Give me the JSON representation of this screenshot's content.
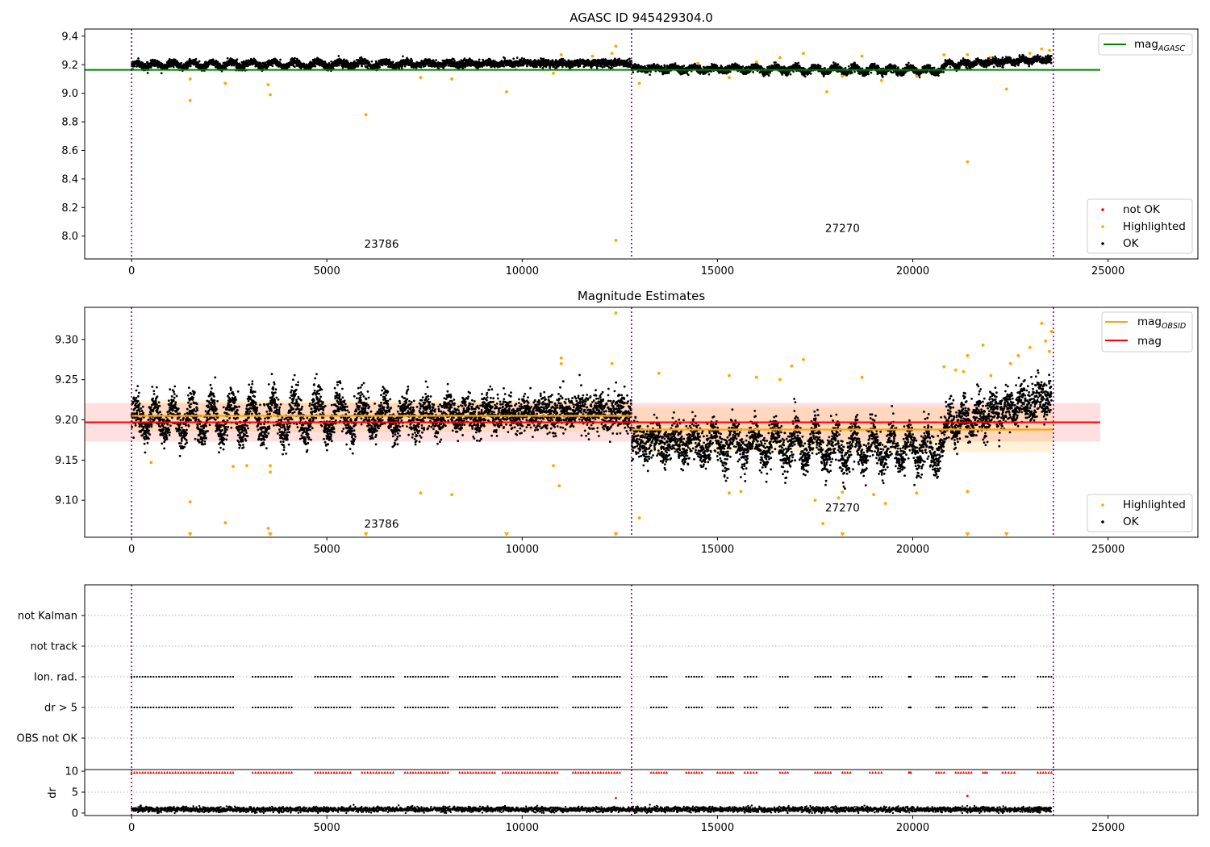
{
  "chart_data": [
    {
      "type": "scatter",
      "title": "AGASC ID 945429304.0",
      "xlim": [
        -1200,
        27300
      ],
      "ylim": [
        7.84,
        9.45
      ],
      "xticks": [
        0,
        5000,
        10000,
        15000,
        20000,
        25000
      ],
      "yticks": [
        8.0,
        8.2,
        8.4,
        8.6,
        8.8,
        9.0,
        9.2,
        9.4
      ],
      "vertical_lines": [
        0,
        12800,
        23600
      ],
      "reference_line": {
        "name_main": "mag",
        "name_sub": "AGASC",
        "value": 9.164,
        "x_range": [
          -1200,
          24800
        ],
        "color": "#008000"
      },
      "annotations": [
        {
          "text": "23786",
          "x": 6400,
          "y": 7.92
        },
        {
          "text": "27270",
          "x": 18200,
          "y": 8.03
        }
      ],
      "series": [
        {
          "name": "not OK",
          "color": "#ff0000",
          "points": []
        },
        {
          "name": "Highlighted",
          "color": "#ffa500",
          "points": [
            [
              1500,
              8.95
            ],
            [
              1500,
              9.1
            ],
            [
              2400,
              9.07
            ],
            [
              3500,
              9.06
            ],
            [
              3550,
              8.99
            ],
            [
              6000,
              8.85
            ],
            [
              7400,
              9.11
            ],
            [
              8200,
              9.1
            ],
            [
              9600,
              9.01
            ],
            [
              10800,
              9.14
            ],
            [
              11000,
              9.27
            ],
            [
              11800,
              9.26
            ],
            [
              12300,
              9.28
            ],
            [
              12400,
              9.33
            ],
            [
              12400,
              7.97
            ],
            [
              13000,
              9.07
            ],
            [
              14500,
              9.21
            ],
            [
              15300,
              9.11
            ],
            [
              16000,
              9.22
            ],
            [
              16600,
              9.25
            ],
            [
              17200,
              9.28
            ],
            [
              17800,
              9.01
            ],
            [
              18200,
              9.12
            ],
            [
              18700,
              9.26
            ],
            [
              19200,
              9.09
            ],
            [
              20100,
              9.12
            ],
            [
              20800,
              9.27
            ],
            [
              21400,
              9.27
            ],
            [
              21400,
              8.52
            ],
            [
              22000,
              9.25
            ],
            [
              22400,
              9.03
            ],
            [
              23000,
              9.28
            ],
            [
              23300,
              9.31
            ],
            [
              23500,
              9.3
            ]
          ]
        },
        {
          "name": "OK",
          "color": "#000000",
          "segments": [
            {
              "x0": 0,
              "x1": 12800,
              "base": 9.2,
              "amp": 0.02,
              "noise": 0.012,
              "period": 520,
              "trend": 0.012
            },
            {
              "x0": 12800,
              "x1": 20800,
              "base": 9.173,
              "amp": 0.02,
              "noise": 0.012,
              "period": 480,
              "trend": -0.01
            },
            {
              "x0": 20800,
              "x1": 23550,
              "base": 9.2,
              "amp": 0.02,
              "noise": 0.012,
              "period": 400,
              "trend": 0.04
            }
          ]
        }
      ],
      "legend_upper": {
        "position": "upper right",
        "entries": [
          {
            "label_main": "mag",
            "label_sub": "AGASC",
            "color": "#008000",
            "kind": "line"
          }
        ]
      },
      "legend_lower": {
        "position": "lower right",
        "entries": [
          {
            "label": "not OK",
            "color": "#ff0000",
            "kind": "dot"
          },
          {
            "label": "Highlighted",
            "color": "#ffa500",
            "kind": "dot"
          },
          {
            "label": "OK",
            "color": "#000000",
            "kind": "dot"
          }
        ]
      }
    },
    {
      "type": "scatter",
      "title": "Magnitude Estimates",
      "xlim": [
        -1200,
        27300
      ],
      "ylim": [
        9.054,
        9.34
      ],
      "xticks": [
        0,
        5000,
        10000,
        15000,
        20000,
        25000
      ],
      "yticks": [
        9.1,
        9.15,
        9.2,
        9.25,
        9.3
      ],
      "ytick_labels": [
        "9.10",
        "9.15",
        "9.20",
        "9.25",
        "9.30"
      ],
      "vertical_lines": [
        0,
        12800,
        23600
      ],
      "mag_line": {
        "name": "mag",
        "value": 9.197,
        "band": [
          9.173,
          9.221
        ],
        "x_range": [
          -1200,
          24800
        ],
        "color": "#ff0000"
      },
      "obsid_mags": [
        {
          "x0": 0,
          "x1": 12800,
          "value": 9.205,
          "band": [
            9.185,
            9.225
          ]
        },
        {
          "x0": 12800,
          "x1": 23600,
          "value": 9.188,
          "band": [
            9.16,
            9.216
          ]
        }
      ],
      "annotations": [
        {
          "text": "23786",
          "x": 6400,
          "y": 9.066
        },
        {
          "text": "27270",
          "x": 18200,
          "y": 9.086
        }
      ],
      "series": [
        {
          "name": "Highlighted",
          "color": "#ffa500",
          "points": [
            [
              500,
              9.147
            ],
            [
              1500,
              9.098
            ],
            [
              2400,
              9.072
            ],
            [
              2600,
              9.142
            ],
            [
              2950,
              9.143
            ],
            [
              3500,
              9.065
            ],
            [
              3550,
              9.135
            ],
            [
              3550,
              9.143
            ],
            [
              7400,
              9.109
            ],
            [
              8200,
              9.107
            ],
            [
              10800,
              9.143
            ],
            [
              10950,
              9.118
            ],
            [
              11000,
              9.27
            ],
            [
              11000,
              9.277
            ],
            [
              12400,
              9.333
            ],
            [
              12300,
              9.27
            ],
            [
              13000,
              9.078
            ],
            [
              13500,
              9.258
            ],
            [
              15300,
              9.109
            ],
            [
              15600,
              9.111
            ],
            [
              15300,
              9.255
            ],
            [
              16000,
              9.253
            ],
            [
              16600,
              9.25
            ],
            [
              16900,
              9.267
            ],
            [
              17200,
              9.275
            ],
            [
              17500,
              9.1
            ],
            [
              17700,
              9.071
            ],
            [
              18100,
              9.103
            ],
            [
              18200,
              9.11
            ],
            [
              18700,
              9.253
            ],
            [
              19000,
              9.107
            ],
            [
              19300,
              9.096
            ],
            [
              20100,
              9.109
            ],
            [
              20800,
              9.266
            ],
            [
              21100,
              9.262
            ],
            [
              21300,
              9.26
            ],
            [
              21400,
              9.111
            ],
            [
              21400,
              9.28
            ],
            [
              21800,
              9.293
            ],
            [
              22000,
              9.255
            ],
            [
              22500,
              9.27
            ],
            [
              22700,
              9.28
            ],
            [
              23000,
              9.29
            ],
            [
              23300,
              9.32
            ],
            [
              23400,
              9.298
            ],
            [
              23500,
              9.285
            ],
            [
              23550,
              9.31
            ]
          ]
        },
        {
          "name": "Highlighted-clipped",
          "color": "#ffa500",
          "points": [
            [
              1500,
              9.057
            ],
            [
              3550,
              9.057
            ],
            [
              6000,
              9.057
            ],
            [
              9600,
              9.057
            ],
            [
              12400,
              9.057
            ],
            [
              18200,
              9.057
            ],
            [
              21400,
              9.057
            ],
            [
              22400,
              9.057
            ]
          ]
        },
        {
          "name": "OK",
          "color": "#000000",
          "segments": [
            {
              "x0": 0,
              "x1": 12800,
              "base": 9.2,
              "amp": 0.022,
              "noise": 0.011,
              "period": 520,
              "trend": 0.01
            },
            {
              "x0": 12800,
              "x1": 20800,
              "base": 9.173,
              "amp": 0.02,
              "noise": 0.012,
              "period": 480,
              "trend": -0.01
            },
            {
              "x0": 20800,
              "x1": 23550,
              "base": 9.19,
              "amp": 0.018,
              "noise": 0.012,
              "period": 400,
              "trend": 0.04
            }
          ]
        }
      ],
      "legend_upper": {
        "position": "upper right",
        "entries": [
          {
            "label_main": "mag",
            "label_sub": "OBSID",
            "color": "#ffa500",
            "kind": "line"
          },
          {
            "label": "mag",
            "color": "#ff0000",
            "kind": "line"
          }
        ]
      },
      "legend_lower": {
        "position": "lower right",
        "entries": [
          {
            "label": "Highlighted",
            "color": "#ffa500",
            "kind": "dot"
          },
          {
            "label": "OK",
            "color": "#000000",
            "kind": "dot"
          }
        ]
      }
    },
    {
      "type": "scatter",
      "title": "",
      "xlim": [
        -1200,
        27300
      ],
      "categories": [
        "not Kalman",
        "not track",
        "Ion. rad.",
        "dr > 5",
        "OBS not OK"
      ],
      "vertical_lines": [
        0,
        12800,
        23600
      ],
      "flag_marks": {
        "rows": [
          "Ion. rad.",
          "dr > 5"
        ],
        "color": "#000000",
        "x_clusters": [
          [
            0,
            2600
          ],
          [
            3100,
            4100
          ],
          [
            4700,
            5600
          ],
          [
            5900,
            6700
          ],
          [
            7000,
            8100
          ],
          [
            8400,
            9300
          ],
          [
            9500,
            10900
          ],
          [
            11300,
            11700
          ],
          [
            11800,
            12500
          ],
          [
            13300,
            13700
          ],
          [
            14200,
            14600
          ],
          [
            15000,
            15400
          ],
          [
            15700,
            16000
          ],
          [
            16600,
            16800
          ],
          [
            17500,
            17900
          ],
          [
            18200,
            18400
          ],
          [
            18900,
            19200
          ],
          [
            19900,
            19950
          ],
          [
            20600,
            20800
          ],
          [
            21100,
            21500
          ],
          [
            21800,
            21900
          ],
          [
            22300,
            22600
          ],
          [
            23200,
            23550
          ]
        ]
      }
    },
    {
      "type": "scatter",
      "title": "",
      "ylabel": "dr",
      "xlim": [
        -1200,
        27300
      ],
      "ylim": [
        -0.6,
        10.4
      ],
      "xticks": [
        0,
        5000,
        10000,
        15000,
        20000,
        25000
      ],
      "yticks": [
        0,
        5,
        10
      ],
      "vertical_lines": [
        0,
        12800,
        23600
      ],
      "series": [
        {
          "name": "dr-clipped",
          "color": "#ff0000",
          "marker": "triangle",
          "y": 9.7,
          "x_clusters_ref": "flag_marks"
        },
        {
          "name": "dr-outliers",
          "color": "#ff0000",
          "points": [
            [
              12400,
              3.6
            ],
            [
              21400,
              4.1
            ]
          ]
        },
        {
          "name": "dr",
          "color": "#000000",
          "base": 0.7,
          "noise": 0.5,
          "x_range": [
            0,
            23550
          ]
        }
      ]
    }
  ]
}
